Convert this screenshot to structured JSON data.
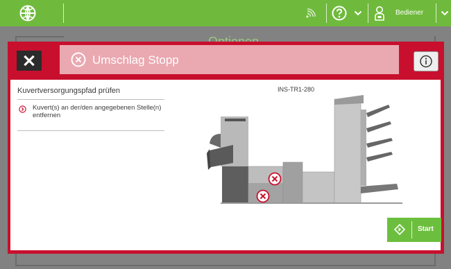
{
  "topbar": {
    "logo_icon": "globe-logo-icon",
    "icons": [
      "signal-icon",
      "help-icon",
      "chevron-down-icon",
      "user-icon",
      "chevron-down-icon"
    ],
    "user_label": "Bediener"
  },
  "background": {
    "title": "Optionen"
  },
  "dialog": {
    "close_icon": "close-icon",
    "title": "Umschlag Stopp",
    "title_icon": "error-circle-icon",
    "info_icon": "info-icon",
    "section_title": "Kuvertversorgungspfad prüfen",
    "steps": [
      {
        "icon": "chevron-right-circle-icon",
        "text": "Kuvert(s) an der/den angegebenen Stelle(n) entfernen"
      }
    ],
    "model": "INS-TR1-280",
    "start_label": "Start",
    "start_icon": "start-diamond-icon"
  },
  "colors": {
    "topbar": "#6fba3c",
    "dialog_frame": "#c8102e",
    "banner": "#eaa8b0",
    "start_button": "#6cbf3e",
    "error_marker": "#c8102e"
  }
}
